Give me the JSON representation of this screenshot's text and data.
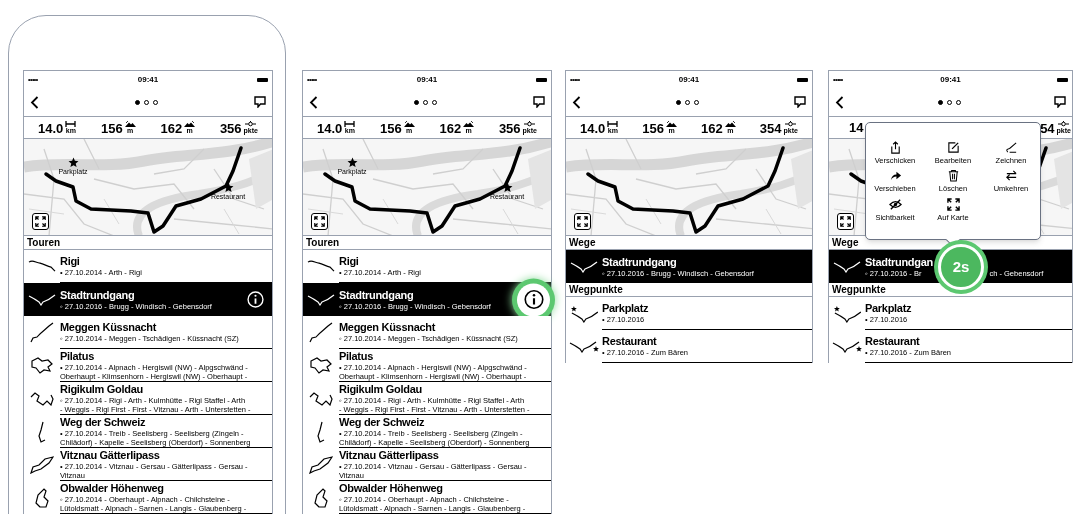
{
  "screens": [
    {
      "status_bar": {
        "signal": "•••••",
        "time": "09:41"
      },
      "page_dots": [
        {
          "selected": true
        },
        {
          "selected": false
        },
        {
          "selected": false
        }
      ],
      "stats": [
        {
          "kind": "distance",
          "value": "14.0",
          "unit": "km"
        },
        {
          "kind": "ascent",
          "value": "156",
          "unit": "m"
        },
        {
          "kind": "descent",
          "value": "162",
          "unit": "m"
        },
        {
          "kind": "points",
          "value": "356",
          "unit": "pkte"
        }
      ],
      "map": {
        "markers": [
          {
            "label": "Parkplatz"
          },
          {
            "label": "Restaurant"
          }
        ]
      },
      "sections": [
        {
          "kind": "tours",
          "title": "Touren",
          "items": [
            {
              "title": "Rigi",
              "subtitle_lines": [
                "• 27.10.2014 - Arth - Rigi"
              ],
              "selected": false
            },
            {
              "title": "Stadtrundgang",
              "subtitle_lines": [
                "◦ 27.10.2016 - Brugg - Windisch - Gebensdorf"
              ],
              "selected": true,
              "info_button": true,
              "info_highlighted": false
            },
            {
              "title": "Meggen Küssnacht",
              "subtitle_lines": [
                "◦ 27.10.2014 - Meggen - Tschädigen - Küssnacht (SZ)"
              ],
              "selected": false
            },
            {
              "title": "Pilatus",
              "subtitle_lines": [
                "• 27.10.2014 - Alpnach - Hergiswil (NW) - Alpgschwänd -",
                "Oberhaupt - Klimsenhorn - Hergiswil (NW) - Oberhaupt -"
              ],
              "selected": false
            },
            {
              "title": "Rigikulm Goldau",
              "subtitle_lines": [
                "◦ 27.10.2014 - Rigi - Arth - Kulmhütte - Rigi Staffel - Arth",
                "- Weggis - Rigi First - First - Vitznau - Arth - Unterstetten -"
              ],
              "selected": false
            },
            {
              "title": "Weg der Schweiz",
              "subtitle_lines": [
                "• 27.10.2014 - Treib - Seelisberg - Seelisberg (Zingeln -",
                "Chilädorf) - Kapelle - Seelisberg (Oberdorf) - Sonnenberg"
              ],
              "selected": false
            },
            {
              "title": "Vitznau Gätterlipass",
              "subtitle_lines": [
                "• 27.10.2014 - Vitznau - Gersau - Gätterlipass - Gersau -",
                "Vitznau"
              ],
              "selected": false
            },
            {
              "title": "Obwalder Höhenweg",
              "subtitle_lines": [
                "◦ 27.10.2014 - Oberhaupt - Alpnach - Chilchsteine -",
                "Lütoldsmatt - Alpnach - Sarnen - Langis - Glaubenberg -"
              ],
              "selected": false
            }
          ]
        }
      ]
    },
    {
      "status_bar": {
        "signal": "•••••",
        "time": "09:41"
      },
      "page_dots": [
        {
          "selected": true
        },
        {
          "selected": false
        },
        {
          "selected": false
        }
      ],
      "stats": [
        {
          "kind": "distance",
          "value": "14.0",
          "unit": "km"
        },
        {
          "kind": "ascent",
          "value": "156",
          "unit": "m"
        },
        {
          "kind": "descent",
          "value": "162",
          "unit": "m"
        },
        {
          "kind": "points",
          "value": "356",
          "unit": "pkte"
        }
      ],
      "map": {
        "markers": [
          {
            "label": "Parkplatz"
          },
          {
            "label": "Restaurant"
          }
        ]
      },
      "sections": [
        {
          "kind": "tours",
          "title": "Touren",
          "items": [
            {
              "title": "Rigi",
              "subtitle_lines": [
                "• 27.10.2014 - Arth - Rigi"
              ],
              "selected": false
            },
            {
              "title": "Stadtrundgang",
              "subtitle_lines": [
                "◦ 27.10.2016 - Brugg - Windisch - Gebensdorf"
              ],
              "selected": true,
              "info_button": true,
              "info_highlighted": true
            },
            {
              "title": "Meggen Küssnacht",
              "subtitle_lines": [
                "◦ 27.10.2014 - Meggen - Tschädigen - Küssnacht (SZ)"
              ],
              "selected": false
            },
            {
              "title": "Pilatus",
              "subtitle_lines": [
                "• 27.10.2014 - Alpnach - Hergiswil (NW) - Alpgschwänd -",
                "Oberhaupt - Klimsenhorn - Hergiswil (NW) - Oberhaupt -"
              ],
              "selected": false
            },
            {
              "title": "Rigikulm Goldau",
              "subtitle_lines": [
                "◦ 27.10.2014 - Rigi - Arth - Kulmhütte - Rigi Staffel - Arth",
                "- Weggis - Rigi First - First - Vitznau - Arth - Unterstetten -"
              ],
              "selected": false
            },
            {
              "title": "Weg der Schweiz",
              "subtitle_lines": [
                "• 27.10.2014 - Treib - Seelisberg - Seelisberg (Zingeln -",
                "Chilädorf) - Kapelle - Seelisberg (Oberdorf) - Sonnenberg"
              ],
              "selected": false
            },
            {
              "title": "Vitznau Gätterlipass",
              "subtitle_lines": [
                "• 27.10.2014 - Vitznau - Gersau - Gätterlipass - Gersau -",
                "Vitznau"
              ],
              "selected": false
            },
            {
              "title": "Obwalder Höhenweg",
              "subtitle_lines": [
                "◦ 27.10.2014 - Oberhaupt - Alpnach - Chilchsteine -",
                "Lütoldsmatt - Alpnach - Sarnen - Langis - Glaubenberg -"
              ],
              "selected": false
            }
          ]
        }
      ]
    },
    {
      "status_bar": {
        "signal": "•••••",
        "time": "09:41"
      },
      "page_dots": [
        {
          "selected": true
        },
        {
          "selected": false
        },
        {
          "selected": false
        }
      ],
      "stats": [
        {
          "kind": "distance",
          "value": "14.0",
          "unit": "km"
        },
        {
          "kind": "ascent",
          "value": "156",
          "unit": "m"
        },
        {
          "kind": "descent",
          "value": "162",
          "unit": "m"
        },
        {
          "kind": "points",
          "value": "354",
          "unit": "pkte"
        }
      ],
      "sections": [
        {
          "kind": "ways",
          "title": "Wege",
          "items": [
            {
              "title": "Stadtrundgang",
              "subtitle_lines": [
                "◦ 27.10.2016 - Brugg - Windisch - Gebensdorf"
              ],
              "selected": true
            }
          ]
        },
        {
          "kind": "waypoints",
          "title": "Wegpunkte",
          "items": [
            {
              "title": "Parkplatz",
              "subtitle_lines": [
                "• 27.10.2016"
              ],
              "selected": false
            },
            {
              "title": "Restaurant",
              "subtitle_lines": [
                "• 27.10.2016 - Zum Bären"
              ],
              "selected": false
            }
          ]
        }
      ]
    },
    {
      "status_bar": {
        "signal": "•••••",
        "time": "09:41"
      },
      "page_dots": [
        {
          "selected": true
        },
        {
          "selected": false
        },
        {
          "selected": false
        }
      ],
      "stats": [
        {
          "value": "14"
        },
        {
          "kind": "points",
          "value": "54",
          "unit": "pkte"
        }
      ],
      "sections": [
        {
          "kind": "ways",
          "title": "Wege",
          "items": [
            {
              "title": "Stadtrundgan",
              "subtitle_parts": [
                "◦ 27.10.2016 - Br",
                "ch - Gebensdorf"
              ],
              "selected": true
            }
          ]
        },
        {
          "kind": "waypoints",
          "title": "Wegpunkte",
          "items": [
            {
              "title": "Parkplatz",
              "subtitle_lines": [
                "• 27.10.2016"
              ],
              "selected": false
            },
            {
              "title": "Restaurant",
              "subtitle_lines": [
                "• 27.10.2016 - Zum Bären"
              ],
              "selected": false
            }
          ]
        }
      ],
      "context_menu": [
        {
          "kind": "share",
          "label": "Verschicken"
        },
        {
          "kind": "edit",
          "label": "Bearbeiten"
        },
        {
          "kind": "draw",
          "label": "Zeichnen"
        },
        {
          "kind": "move",
          "label": "Verschieben"
        },
        {
          "kind": "delete",
          "label": "Löschen"
        },
        {
          "kind": "reverse",
          "label": "Umkehren"
        },
        {
          "kind": "visibility",
          "label": "Sichtbarkeit"
        },
        {
          "kind": "map",
          "label": "Auf Karte"
        }
      ],
      "long_press_badge": "2s"
    }
  ]
}
